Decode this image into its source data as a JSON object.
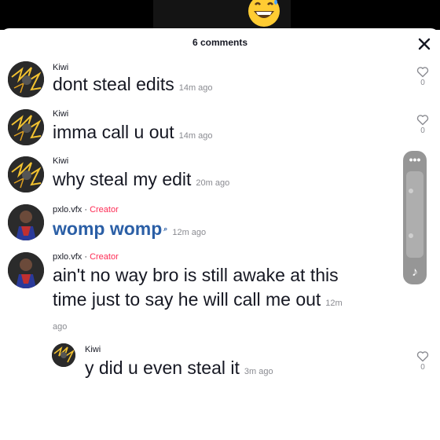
{
  "panel": {
    "title": "6 comments"
  },
  "comments": [
    {
      "user": "Kiwi",
      "role": "",
      "text": "dont steal edits",
      "time": "14m ago",
      "likes": "0"
    },
    {
      "user": "Kiwi",
      "role": "",
      "text": "imma call u out",
      "time": "14m ago",
      "likes": "0"
    },
    {
      "user": "Kiwi",
      "role": "",
      "text": "why steal my edit",
      "time": "20m ago",
      "likes": ""
    },
    {
      "user": "pxlo.vfx",
      "role": "Creator",
      "text": "womp womp",
      "time": "12m ago",
      "likes": ""
    },
    {
      "user": "pxlo.vfx",
      "role": "Creator",
      "text_line1": "ain't no way bro is still awake at this",
      "text_line2": "time just to say he will call me out",
      "time_a": "12m",
      "time_b": "ago",
      "likes": ""
    }
  ],
  "reply": {
    "user": "Kiwi",
    "text": "y did u even steal it",
    "time": "3m ago",
    "likes": "0"
  },
  "colors": {
    "creator": "#fe2c55",
    "link": "#2b5fa6",
    "muted": "#8a8b91",
    "text": "#161823"
  },
  "icons": [
    "close-icon",
    "heart-icon",
    "more-icon",
    "music-note-icon",
    "grinning-sweat-emoji"
  ]
}
